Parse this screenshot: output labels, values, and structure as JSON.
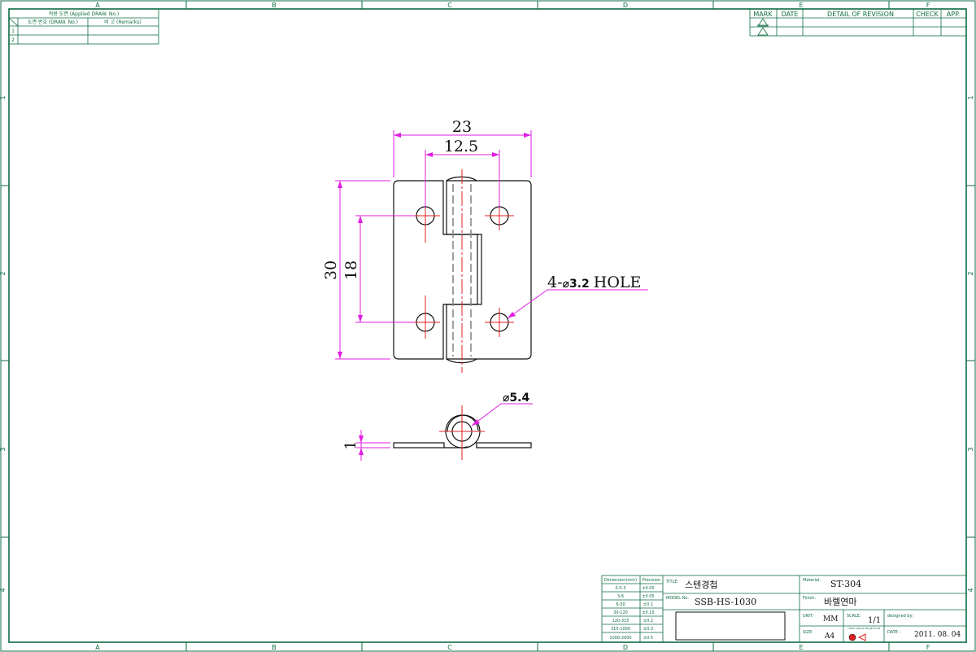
{
  "zones": {
    "columns": [
      "A",
      "B",
      "C",
      "D",
      "E",
      "F"
    ],
    "rows": [
      "1",
      "2",
      "3",
      "4"
    ]
  },
  "applied_table": {
    "title": "적용 도면 (Applied DRAW. No.)",
    "col1": "도면 번호 (DRAW. No.)",
    "col2": "비 고 (Remarks)",
    "rows": [
      "1",
      "2"
    ]
  },
  "revision_table": {
    "headers": [
      "MARK",
      "DATE",
      "DETAIL OF REVISION",
      "CHECK",
      "APP."
    ]
  },
  "dimensions": {
    "width": "23",
    "hole_pitch_x": "12.5",
    "height": "30",
    "hole_pitch_y": "18",
    "hole_note_prefix": "4-",
    "hole_note_dia": "⌀3.2",
    "hole_note_suffix": "HOLE",
    "pin_dia": "⌀5.4",
    "thickness": "1"
  },
  "title_block": {
    "tolerance_headers": [
      "Dimension(mm)",
      "Precision"
    ],
    "tolerances": [
      [
        "0.5-3",
        "±0.05"
      ],
      [
        "3-6",
        "±0.05"
      ],
      [
        "6-30",
        "±0.1"
      ],
      [
        "30-120",
        "±0.15"
      ],
      [
        "120-315",
        "±0.2"
      ],
      [
        "315-1000",
        "±0.3"
      ],
      [
        "1000-2000",
        "±0.5"
      ]
    ],
    "title_label": "TITLE:",
    "title": "스텐경첩",
    "model_label": "MODEL No.",
    "model": "SSB-HS-1030",
    "material_label": "Material:",
    "material": "ST-304",
    "finish_label": "Finish:",
    "finish": "바렐연마",
    "unit_label": "UNIT:",
    "unit": "MM",
    "scale_label": "SCALE:",
    "scale": "1/1",
    "designed_label": "designed by:",
    "size_label": "SIZE:",
    "size": "A4",
    "projection_label": "THIRD ANGLE PROJECTION",
    "date_label": "DATE :",
    "date": "2011. 08. 04"
  },
  "colors": {
    "frame": "#0e6b43",
    "outline": "#111111",
    "center_line": "#e02020",
    "dimension": "#e01ee0",
    "hidden": "#888888"
  }
}
